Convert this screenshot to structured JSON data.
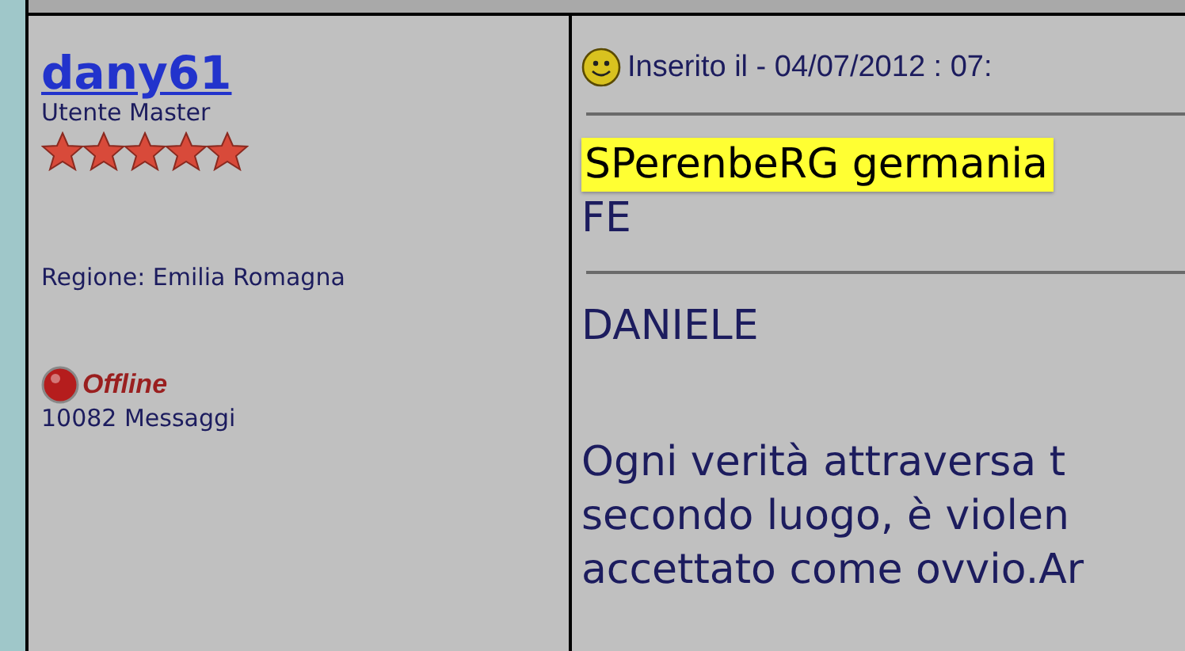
{
  "author": {
    "name": "dany61",
    "rank": "Utente Master",
    "stars": 5,
    "region": "Regione: Emilia Romagna",
    "online": false,
    "status": "Offline",
    "posts": "10082 Messaggi"
  },
  "post": {
    "posted": "Inserito il - 04/07/2012 : 07:",
    "highlight": "SPerenbeRG germania",
    "location": "FE",
    "signature": "DANIELE",
    "quote": [
      "Ogni verità attraversa t",
      "secondo luogo, è violen",
      "accettato come ovvio.Ar"
    ]
  }
}
